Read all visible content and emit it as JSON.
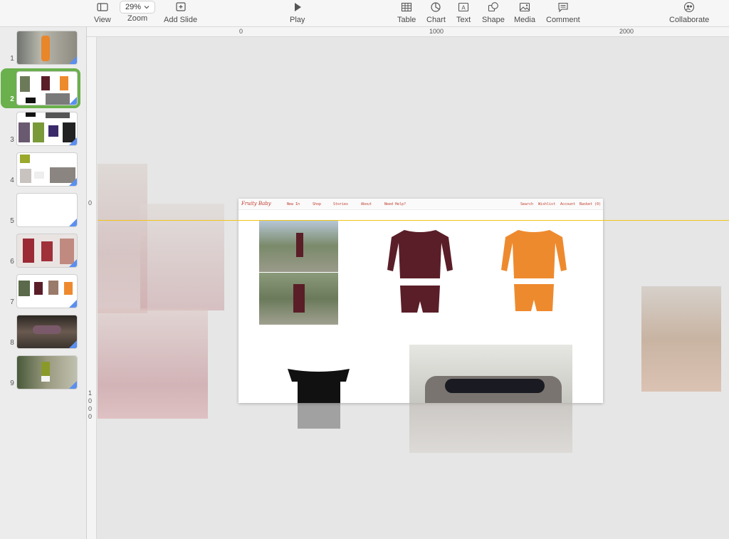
{
  "toolbar": {
    "view_label": "View",
    "zoom_value": "29%",
    "zoom_label": "Zoom",
    "add_slide_label": "Add Slide",
    "play_label": "Play",
    "table_label": "Table",
    "chart_label": "Chart",
    "text_label": "Text",
    "shape_label": "Shape",
    "media_label": "Media",
    "comment_label": "Comment",
    "collaborate_label": "Collaborate"
  },
  "ruler": {
    "top_labels": [
      "0",
      "1000",
      "2000"
    ],
    "left_labels": [
      "0",
      "1",
      "0",
      "0",
      "0"
    ]
  },
  "slides": [
    {
      "number": "1"
    },
    {
      "number": "2",
      "selected": true
    },
    {
      "number": "3"
    },
    {
      "number": "4"
    },
    {
      "number": "5"
    },
    {
      "number": "6"
    },
    {
      "number": "7"
    },
    {
      "number": "8"
    },
    {
      "number": "9"
    }
  ],
  "slide_content": {
    "logo": "Fruity Baby",
    "nav_left": [
      "New In",
      "Shop",
      "Stories",
      "About",
      "Need Help?"
    ],
    "nav_right": [
      "Search",
      "Wishlist",
      "Account",
      "Basket (0)"
    ]
  },
  "colors": {
    "accent_green": "#6ab04c",
    "guide_yellow": "#f0c419",
    "maroon": "#5a1e28",
    "orange": "#ee8a2e"
  }
}
